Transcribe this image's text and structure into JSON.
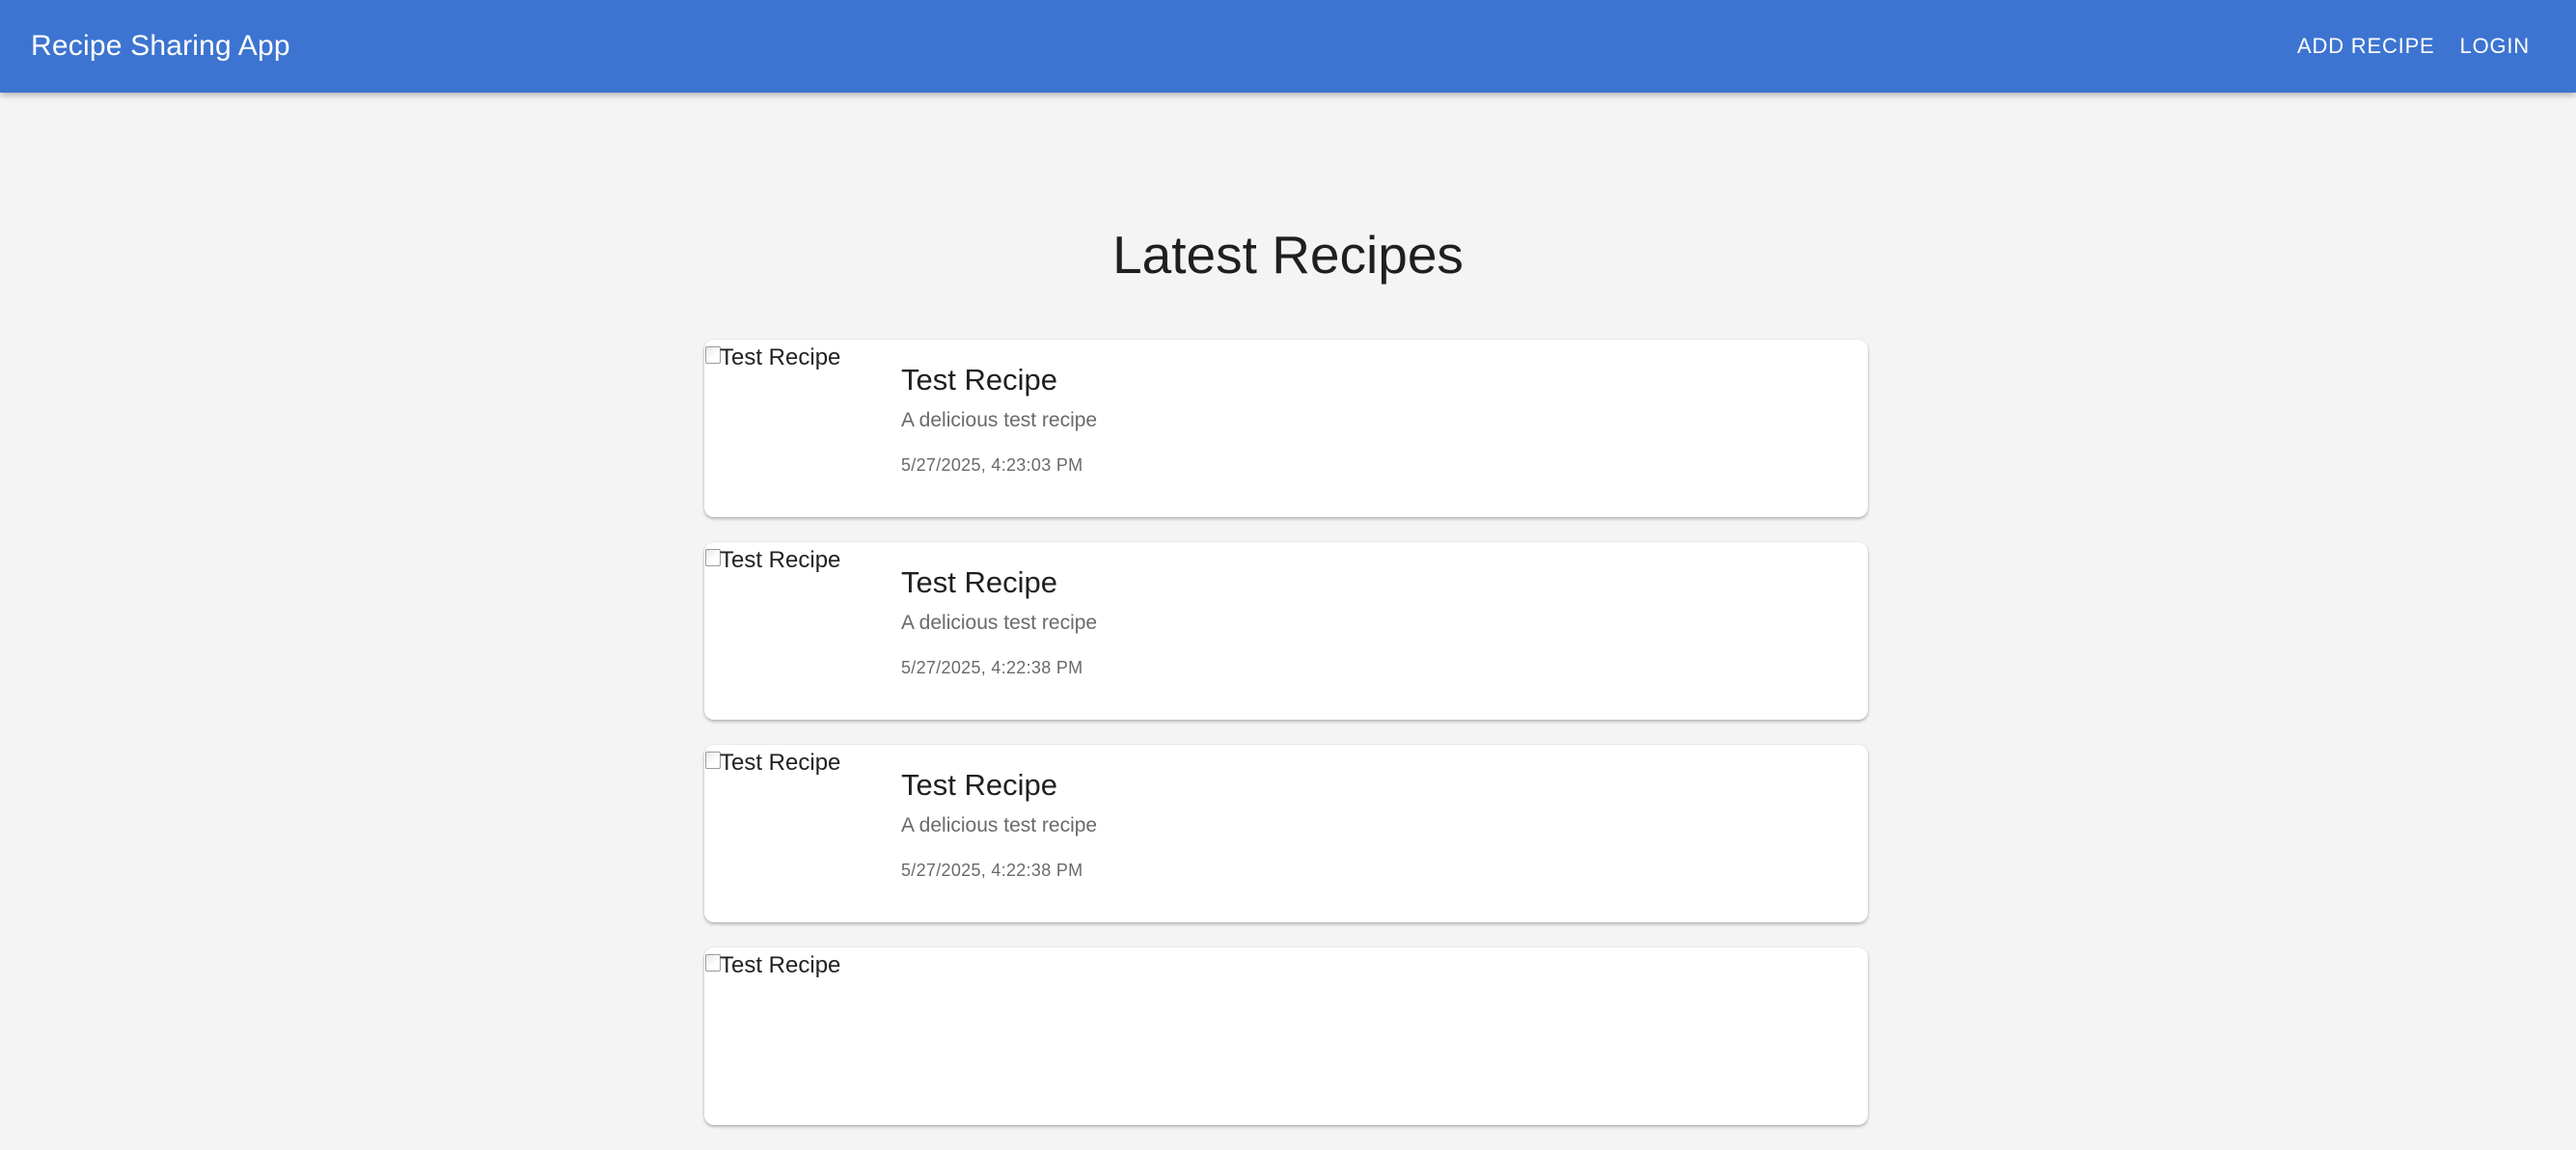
{
  "header": {
    "title": "Recipe Sharing App",
    "nav": [
      {
        "label": "Add Recipe"
      },
      {
        "label": "Login"
      }
    ]
  },
  "main": {
    "heading": "Latest Recipes",
    "recipes": [
      {
        "image_alt": "Test Recipe",
        "title": "Test Recipe",
        "description": "A delicious test recipe",
        "date": "5/27/2025, 4:23:03 PM"
      },
      {
        "image_alt": "Test Recipe",
        "title": "Test Recipe",
        "description": "A delicious test recipe",
        "date": "5/27/2025, 4:22:38 PM"
      },
      {
        "image_alt": "Test Recipe",
        "title": "Test Recipe",
        "description": "A delicious test recipe",
        "date": "5/27/2025, 4:22:38 PM"
      },
      {
        "image_alt": "Test Recipe"
      }
    ]
  },
  "colors": {
    "appbar": "#3d74d1",
    "background": "#f4f4f4",
    "card": "#ffffff"
  },
  "icons": {
    "image_placeholder": "broken-image-icon"
  }
}
